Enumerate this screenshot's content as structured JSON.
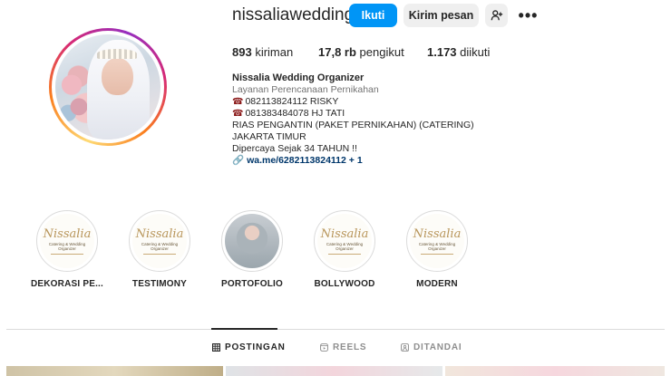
{
  "profile": {
    "username": "nissaliawedding",
    "follow_label": "Ikuti",
    "message_label": "Kirim pesan"
  },
  "stats": {
    "posts_count": "893",
    "posts_label": "kiriman",
    "followers_count": "17,8 rb",
    "followers_label": "pengikut",
    "following_count": "1.173",
    "following_label": "diikuti"
  },
  "bio": {
    "name": "Nissalia Wedding Organizer",
    "category": "Layanan Perencanaan Pernikahan",
    "phone1": "082113824112 RISKY",
    "phone2": "081383484078 HJ TATI",
    "line1": "RIAS PENGANTIN (PAKET PERNIKAHAN) (CATERING)",
    "line2": "JAKARTA TIMUR",
    "line3": "Dipercaya Sejak 34 TAHUN !!",
    "link": "wa.me/6282113824112 + 1"
  },
  "highlights": [
    {
      "label": "DEKORASI PE...",
      "logo": "Nissalia",
      "sub": "Catering & Wedding Organizer"
    },
    {
      "label": "TESTIMONY",
      "logo": "Nissalia",
      "sub": "Catering & Wedding Organizer"
    },
    {
      "label": "PORTOFOLIO"
    },
    {
      "label": "BOLLYWOOD",
      "logo": "Nissalia",
      "sub": "Catering & Wedding Organizer"
    },
    {
      "label": "MODERN",
      "logo": "Nissalia",
      "sub": "Catering & Wedding Organizer"
    }
  ],
  "tabs": [
    {
      "label": "POSTINGAN",
      "icon": "grid-icon",
      "active": true
    },
    {
      "label": "REELS",
      "icon": "reels-icon",
      "active": false
    },
    {
      "label": "DITANDAI",
      "icon": "tagged-icon",
      "active": false
    }
  ],
  "colors": {
    "accent": "#0095f6",
    "link": "#00376b",
    "secondary_button": "#efefef"
  }
}
